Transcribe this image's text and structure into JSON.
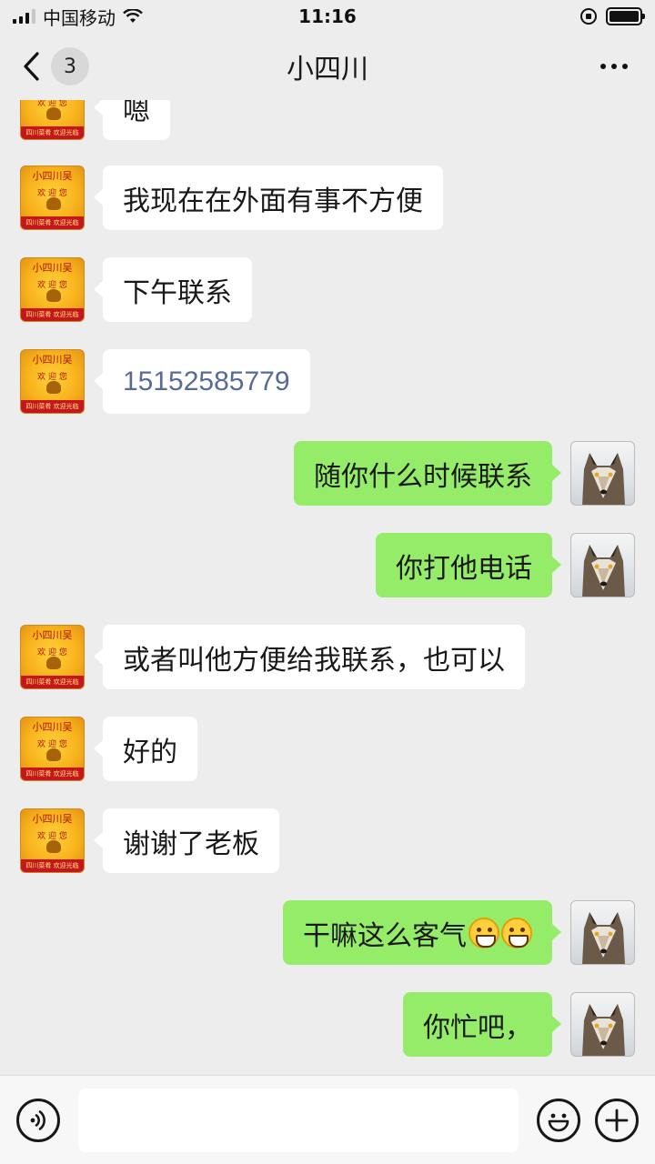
{
  "status_bar": {
    "carrier": "中国移动",
    "time": "11:16"
  },
  "nav": {
    "unread_count": "3",
    "title": "小四川"
  },
  "avatars": {
    "shop_line1": "小四川吴",
    "shop_line2": "欢 迎 您",
    "shop_line3": "四川菜肴 欢迎光临"
  },
  "messages": [
    {
      "side": "left",
      "text": "嗯"
    },
    {
      "side": "left",
      "text": "我现在在外面有事不方便"
    },
    {
      "side": "left",
      "text": "下午联系"
    },
    {
      "side": "left",
      "text": "15152585779"
    },
    {
      "side": "right",
      "text": "随你什么时候联系"
    },
    {
      "side": "right",
      "text": "你打他电话"
    },
    {
      "side": "left",
      "text": "或者叫他方便给我联系，也可以"
    },
    {
      "side": "left",
      "text": "好的"
    },
    {
      "side": "left",
      "text": "谢谢了老板"
    },
    {
      "side": "right",
      "text": "干嘛这么客气",
      "emoji": "grinning-face-emoji x2"
    },
    {
      "side": "right",
      "text": "你忙吧，"
    }
  ],
  "colors": {
    "background": "#ededed",
    "received_bubble": "#ffffff",
    "sent_bubble": "#95ec69",
    "phone_link": "#576b95"
  },
  "icons": {
    "back": "chevron-left-icon",
    "more": "more-dots-icon",
    "voice": "voice-icon",
    "emoji": "emoji-icon",
    "add": "plus-icon"
  }
}
